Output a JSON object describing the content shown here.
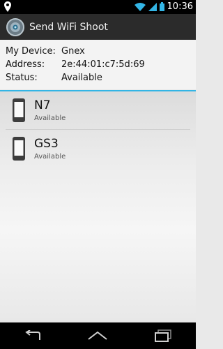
{
  "status_bar": {
    "time": "10:36"
  },
  "app": {
    "title": "Send WiFi Shoot"
  },
  "device_info": [
    {
      "label": "My Device:",
      "value": "Gnex"
    },
    {
      "label": "Address:",
      "value": "2e:44:01:c7:5d:69"
    },
    {
      "label": "Status:",
      "value": "Available"
    }
  ],
  "peers": [
    {
      "name": "N7",
      "status": "Available"
    },
    {
      "name": "GS3",
      "status": "Available"
    }
  ],
  "colors": {
    "accent": "#33b5e5",
    "action_bar": "#2b2b2b",
    "status_bar": "#000000"
  },
  "icons": {
    "status_left": "location-pin-icon",
    "wifi": "wifi-icon",
    "signal": "signal-icon",
    "battery": "battery-icon",
    "app": "wifi-shoot-app-icon",
    "peer": "phone-icon",
    "nav_back": "back-icon",
    "nav_home": "home-icon",
    "nav_recent": "recent-apps-icon"
  }
}
